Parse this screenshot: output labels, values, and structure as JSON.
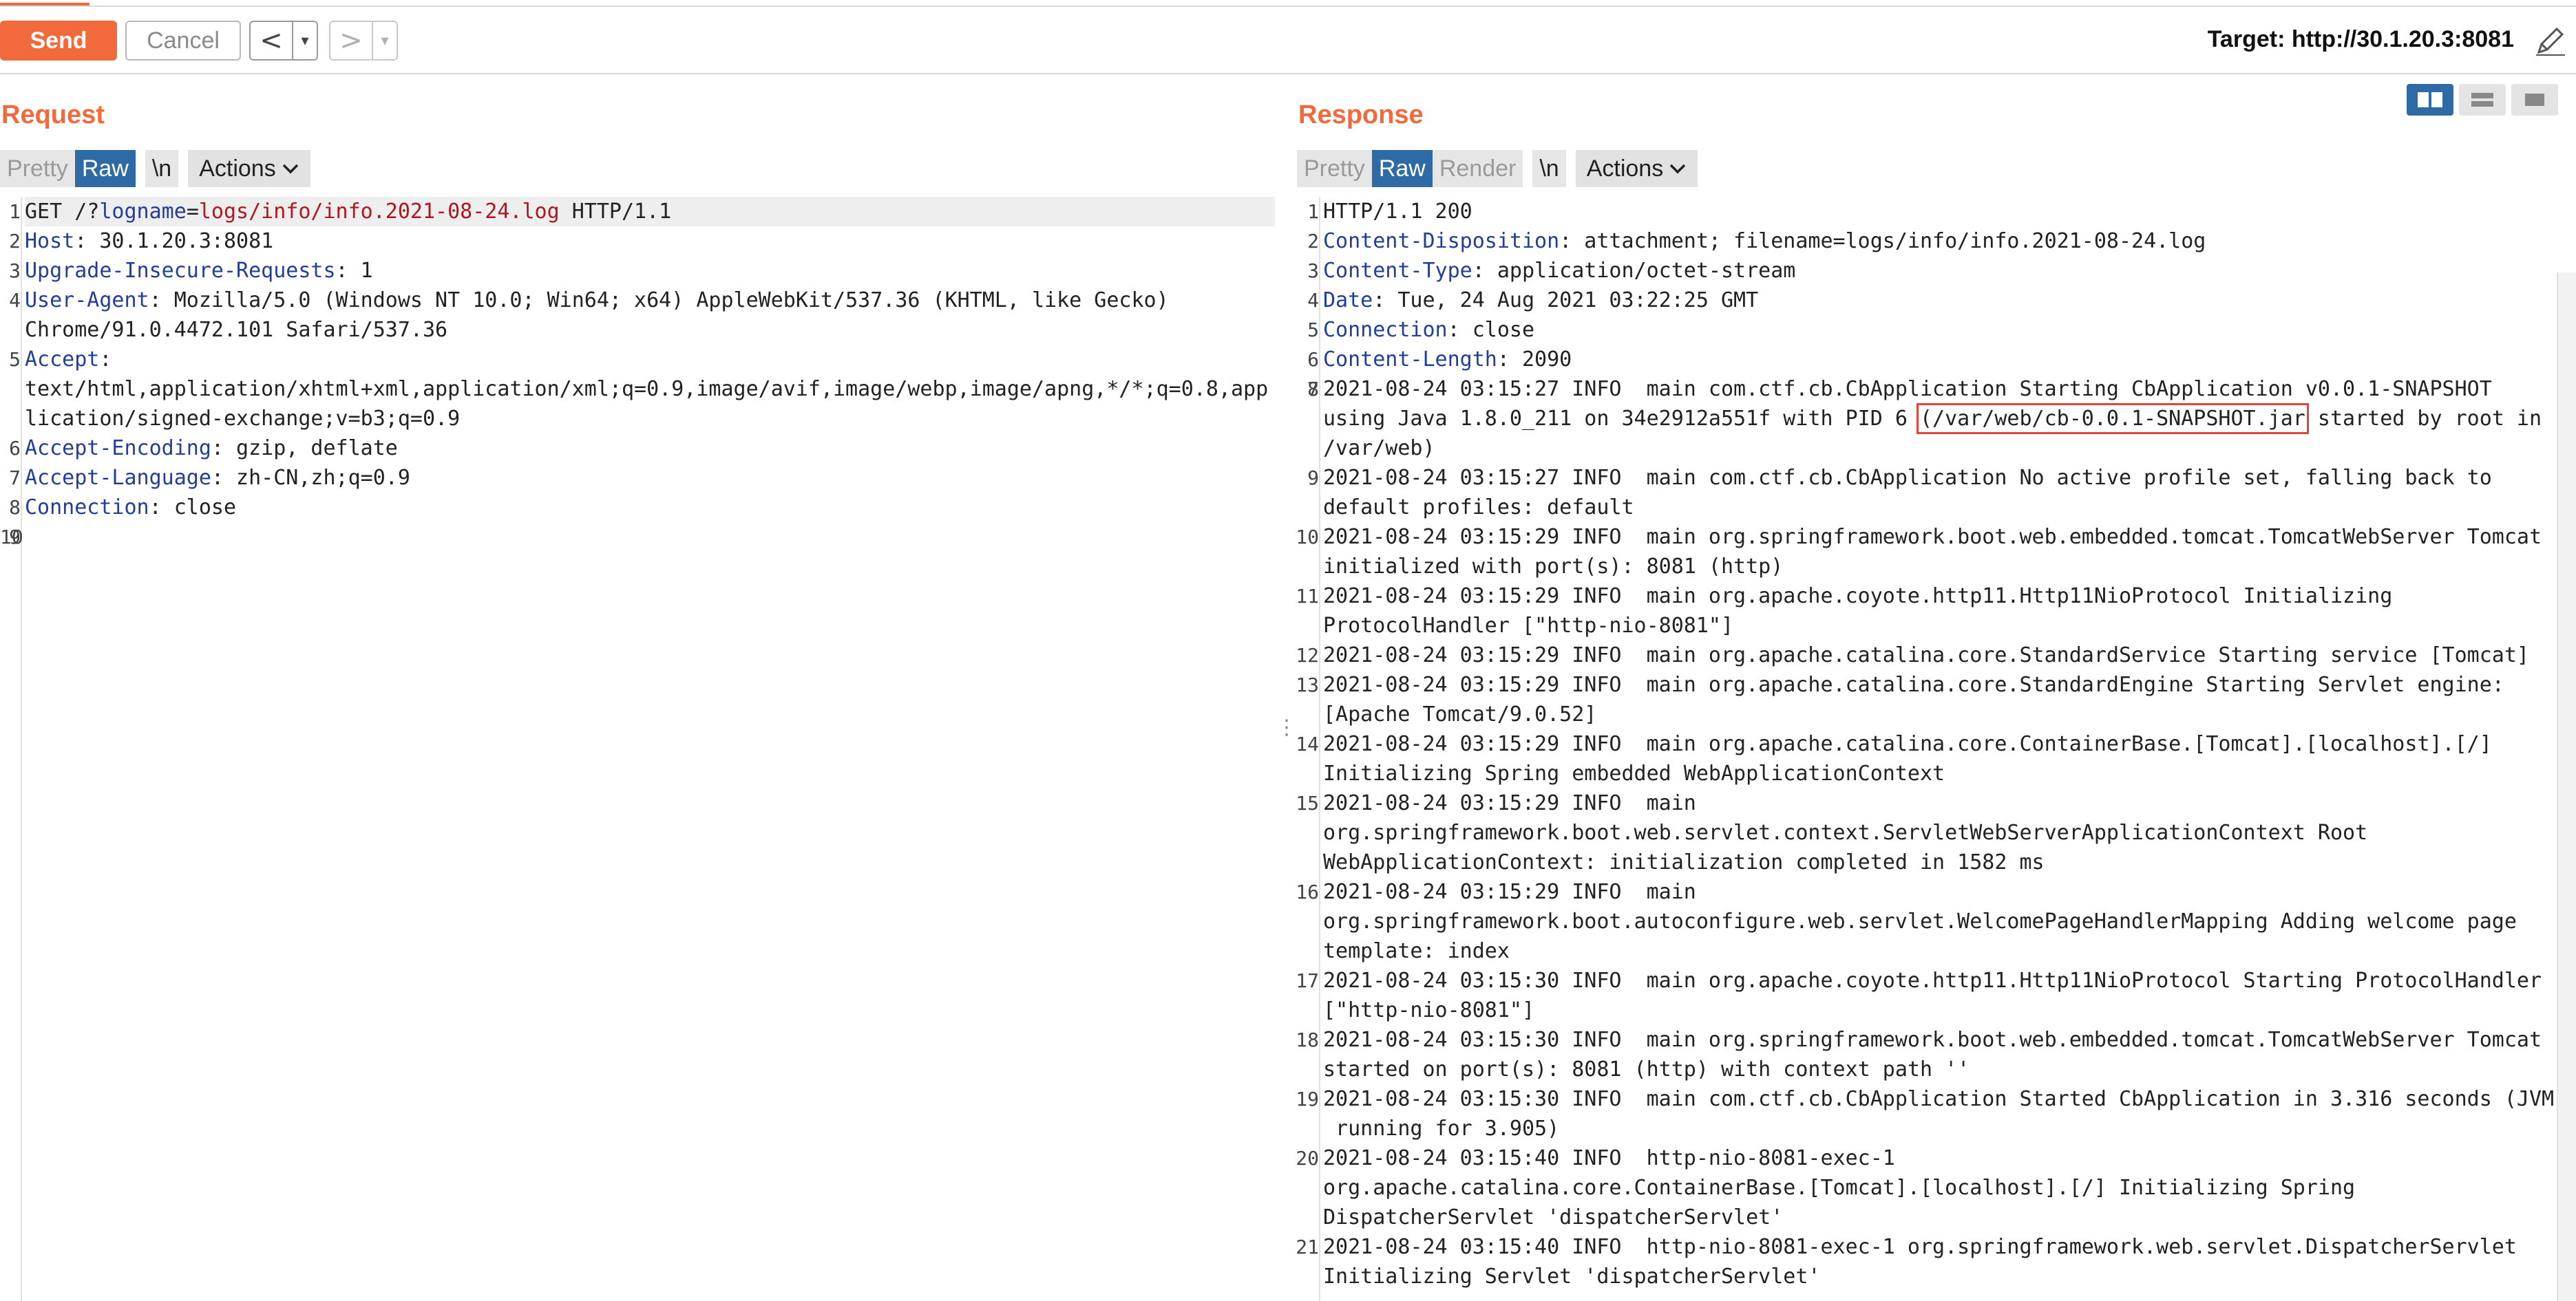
{
  "toolbar": {
    "send_label": "Send",
    "cancel_label": "Cancel",
    "back_glyph": "<",
    "forward_glyph": ">",
    "dropdown_glyph": "▾",
    "target_text": "Target: http://30.1.20.3:8081"
  },
  "request": {
    "title": "Request",
    "tabs": {
      "pretty": "Pretty",
      "raw": "Raw",
      "newline": "\\n",
      "actions": "Actions"
    },
    "lines": [
      {
        "n": "1",
        "method": "GET /?",
        "pkey": "logname",
        "eq": "=",
        "pval": "logs/info/info.2021-08-24.log",
        "rest": " HTTP/1.1"
      },
      {
        "n": "2",
        "key": "Host",
        "val": ": 30.1.20.3:8081"
      },
      {
        "n": "3",
        "key": "Upgrade-Insecure-Requests",
        "val": ": 1"
      },
      {
        "n": "4",
        "key": "User-Agent",
        "val": ": Mozilla/5.0 (Windows NT 10.0; Win64; x64) AppleWebKit/537.36 (KHTML, like Gecko)"
      },
      {
        "n": "",
        "text": "Chrome/91.0.4472.101 Safari/537.36"
      },
      {
        "n": "5",
        "key": "Accept",
        "val": ":"
      },
      {
        "n": "",
        "text": "text/html,application/xhtml+xml,application/xml;q=0.9,image/avif,image/webp,image/apng,*/*;q=0.8,app"
      },
      {
        "n": "",
        "text": "lication/signed-exchange;v=b3;q=0.9"
      },
      {
        "n": "6",
        "key": "Accept-Encoding",
        "val": ": gzip, deflate"
      },
      {
        "n": "7",
        "key": "Accept-Language",
        "val": ": zh-CN,zh;q=0.9"
      },
      {
        "n": "8",
        "key": "Connection",
        "val": ": close"
      },
      {
        "n": "9",
        "text": ""
      },
      {
        "n": "10",
        "text": ""
      }
    ]
  },
  "response": {
    "title": "Response",
    "tabs": {
      "pretty": "Pretty",
      "raw": "Raw",
      "render": "Render",
      "newline": "\\n",
      "actions": "Actions"
    },
    "status_line": "HTTP/1.1 200",
    "headers": [
      {
        "n": "2",
        "key": "Content-Disposition",
        "val": ": attachment; filename=logs/info/info.2021-08-24.log"
      },
      {
        "n": "3",
        "key": "Content-Type",
        "val": ": application/octet-stream"
      },
      {
        "n": "4",
        "key": "Date",
        "val": ": Tue, 24 Aug 2021 03:22:25 GMT"
      },
      {
        "n": "5",
        "key": "Connection",
        "val": ": close"
      },
      {
        "n": "6",
        "key": "Content-Length",
        "val": ": 2090"
      }
    ],
    "line8_a": "2021-08-24 03:15:27 INFO  main com.ctf.cb.CbApplication Starting CbApplication v0.0.1-SNAPSHOT",
    "line8_b_pre": "using Java 1.8.0_211 on 34e2912a551f with PID 6 ",
    "line8_b_box": "(/var/web/cb-0.0.1-SNAPSHOT.jar",
    "line8_b_post": " started by root in",
    "line8_c": "/var/web)",
    "body_lines": [
      {
        "n": "9",
        "text": "2021-08-24 03:15:27 INFO  main com.ctf.cb.CbApplication No active profile set, falling back to"
      },
      {
        "n": "",
        "text": "default profiles: default"
      },
      {
        "n": "10",
        "text": "2021-08-24 03:15:29 INFO  main org.springframework.boot.web.embedded.tomcat.TomcatWebServer Tomcat"
      },
      {
        "n": "",
        "text": "initialized with port(s): 8081 (http)"
      },
      {
        "n": "11",
        "text": "2021-08-24 03:15:29 INFO  main org.apache.coyote.http11.Http11NioProtocol Initializing"
      },
      {
        "n": "",
        "text": "ProtocolHandler [\"http-nio-8081\"]"
      },
      {
        "n": "12",
        "text": "2021-08-24 03:15:29 INFO  main org.apache.catalina.core.StandardService Starting service [Tomcat]"
      },
      {
        "n": "13",
        "text": "2021-08-24 03:15:29 INFO  main org.apache.catalina.core.StandardEngine Starting Servlet engine:"
      },
      {
        "n": "",
        "text": "[Apache Tomcat/9.0.52]"
      },
      {
        "n": "14",
        "text": "2021-08-24 03:15:29 INFO  main org.apache.catalina.core.ContainerBase.[Tomcat].[localhost].[/]"
      },
      {
        "n": "",
        "text": "Initializing Spring embedded WebApplicationContext"
      },
      {
        "n": "15",
        "text": "2021-08-24 03:15:29 INFO  main"
      },
      {
        "n": "",
        "text": "org.springframework.boot.web.servlet.context.ServletWebServerApplicationContext Root"
      },
      {
        "n": "",
        "text": "WebApplicationContext: initialization completed in 1582 ms"
      },
      {
        "n": "16",
        "text": "2021-08-24 03:15:29 INFO  main"
      },
      {
        "n": "",
        "text": "org.springframework.boot.autoconfigure.web.servlet.WelcomePageHandlerMapping Adding welcome page"
      },
      {
        "n": "",
        "text": "template: index"
      },
      {
        "n": "17",
        "text": "2021-08-24 03:15:30 INFO  main org.apache.coyote.http11.Http11NioProtocol Starting ProtocolHandler"
      },
      {
        "n": "",
        "text": "[\"http-nio-8081\"]"
      },
      {
        "n": "18",
        "text": "2021-08-24 03:15:30 INFO  main org.springframework.boot.web.embedded.tomcat.TomcatWebServer Tomcat"
      },
      {
        "n": "",
        "text": "started on port(s): 8081 (http) with context path ''"
      },
      {
        "n": "19",
        "text": "2021-08-24 03:15:30 INFO  main com.ctf.cb.CbApplication Started CbApplication in 3.316 seconds (JVM"
      },
      {
        "n": "",
        "text": " running for 3.905)"
      },
      {
        "n": "20",
        "text": "2021-08-24 03:15:40 INFO  http-nio-8081-exec-1"
      },
      {
        "n": "",
        "text": "org.apache.catalina.core.ContainerBase.[Tomcat].[localhost].[/] Initializing Spring"
      },
      {
        "n": "",
        "text": "DispatcherServlet 'dispatcherServlet'"
      },
      {
        "n": "21",
        "text": "2021-08-24 03:15:40 INFO  http-nio-8081-exec-1 org.springframework.web.servlet.DispatcherServlet"
      },
      {
        "n": "",
        "text": "Initializing Servlet 'dispatcherServlet'"
      }
    ]
  },
  "colors": {
    "accent": "#f26a3c",
    "active_tab": "#2d6aa6",
    "header_key": "#1f3f9a",
    "param_value": "#b0161e",
    "highlight_box": "#e0453a"
  },
  "icons": [
    "pencil-icon",
    "split-view-icon",
    "horizontal-view-icon",
    "single-view-icon",
    "chevron-down-icon"
  ]
}
